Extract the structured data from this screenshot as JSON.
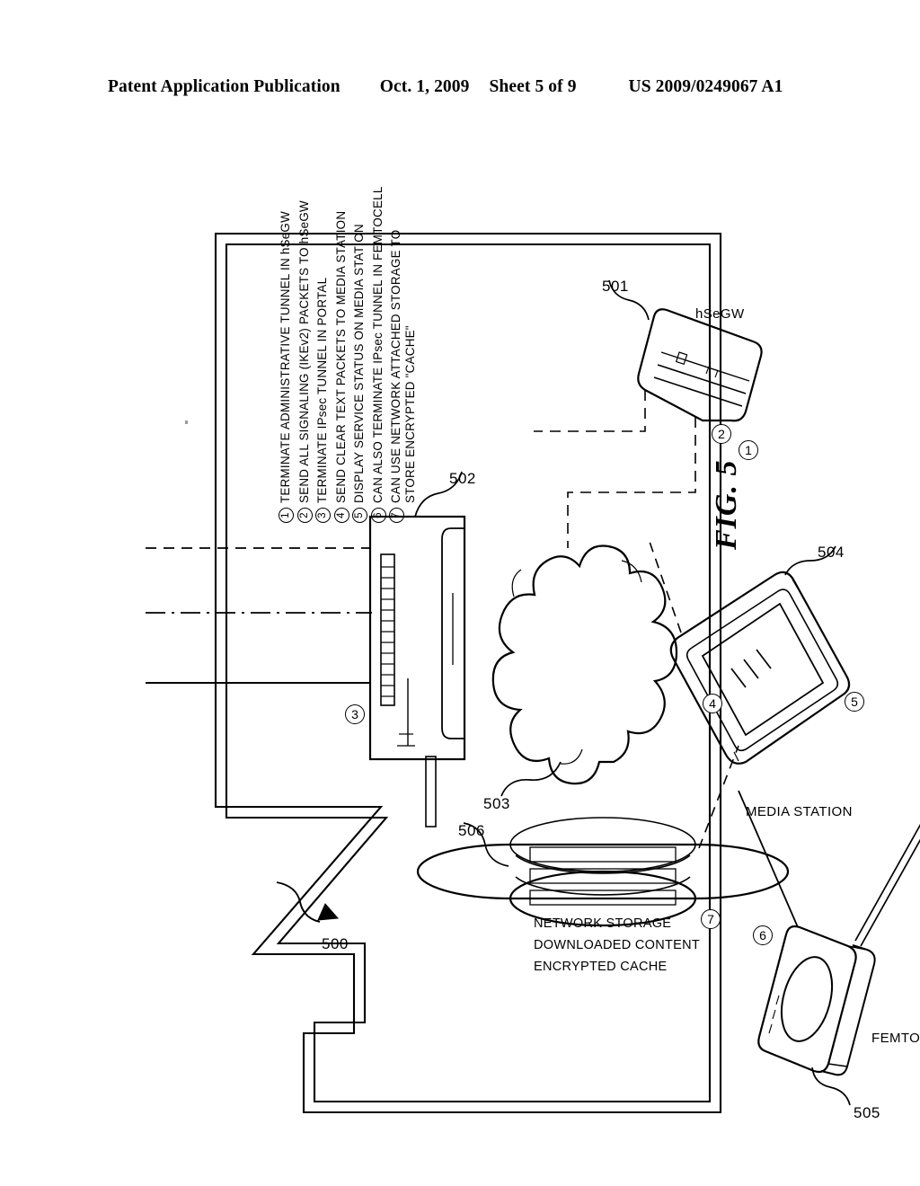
{
  "header": {
    "publication": "Patent Application Publication",
    "date": "Oct. 1, 2009",
    "sheet": "Sheet 5 of 9",
    "patent_number": "US 2009/0249067 A1"
  },
  "figure": {
    "label": "FIG. 5",
    "system_reference": "500"
  },
  "legend": {
    "items": [
      {
        "marker": "1",
        "text": "TERMINATE ADMINISTRATIVE TUNNEL IN hSeGW"
      },
      {
        "marker": "2",
        "text": "SEND ALL SIGNALING (IKEv2) PACKETS TO hSeGW"
      },
      {
        "marker": "3",
        "text": "TERMINATE IPsec TUNNEL IN PORTAL"
      },
      {
        "marker": "4",
        "text": "SEND CLEAR TEXT PACKETS TO MEDIA STATION"
      },
      {
        "marker": "5",
        "text": "DISPLAY SERVICE STATUS ON MEDIA STATION"
      },
      {
        "marker": "6",
        "text": "CAN ALSO TERMINATE IPsec TUNNEL IN FEMTOCELL"
      },
      {
        "marker": "7",
        "text": "CAN USE NETWORK ATTACHED STORAGE TO",
        "text2": "STORE ENCRYPTED \"CACHE\""
      }
    ]
  },
  "components": {
    "hsegw": {
      "label": "hSeGW",
      "reference": "501",
      "markers": [
        "1",
        "2"
      ]
    },
    "portal": {
      "reference": "502",
      "markers": [
        "3"
      ]
    },
    "cloud": {
      "reference": "503",
      "markers": [
        "4"
      ]
    },
    "media_station": {
      "label": "MEDIA STATION",
      "reference": "504",
      "markers": [
        "5"
      ]
    },
    "femtocell": {
      "label": "FEMTOCELL",
      "reference": "505",
      "markers": [
        "6"
      ]
    },
    "storage": {
      "reference": "506",
      "markers": [
        "7"
      ],
      "bands": [
        "ENCRYPTED CACHE",
        "DOWNLOADED CONTENT",
        "NETWORK STORAGE"
      ]
    }
  }
}
